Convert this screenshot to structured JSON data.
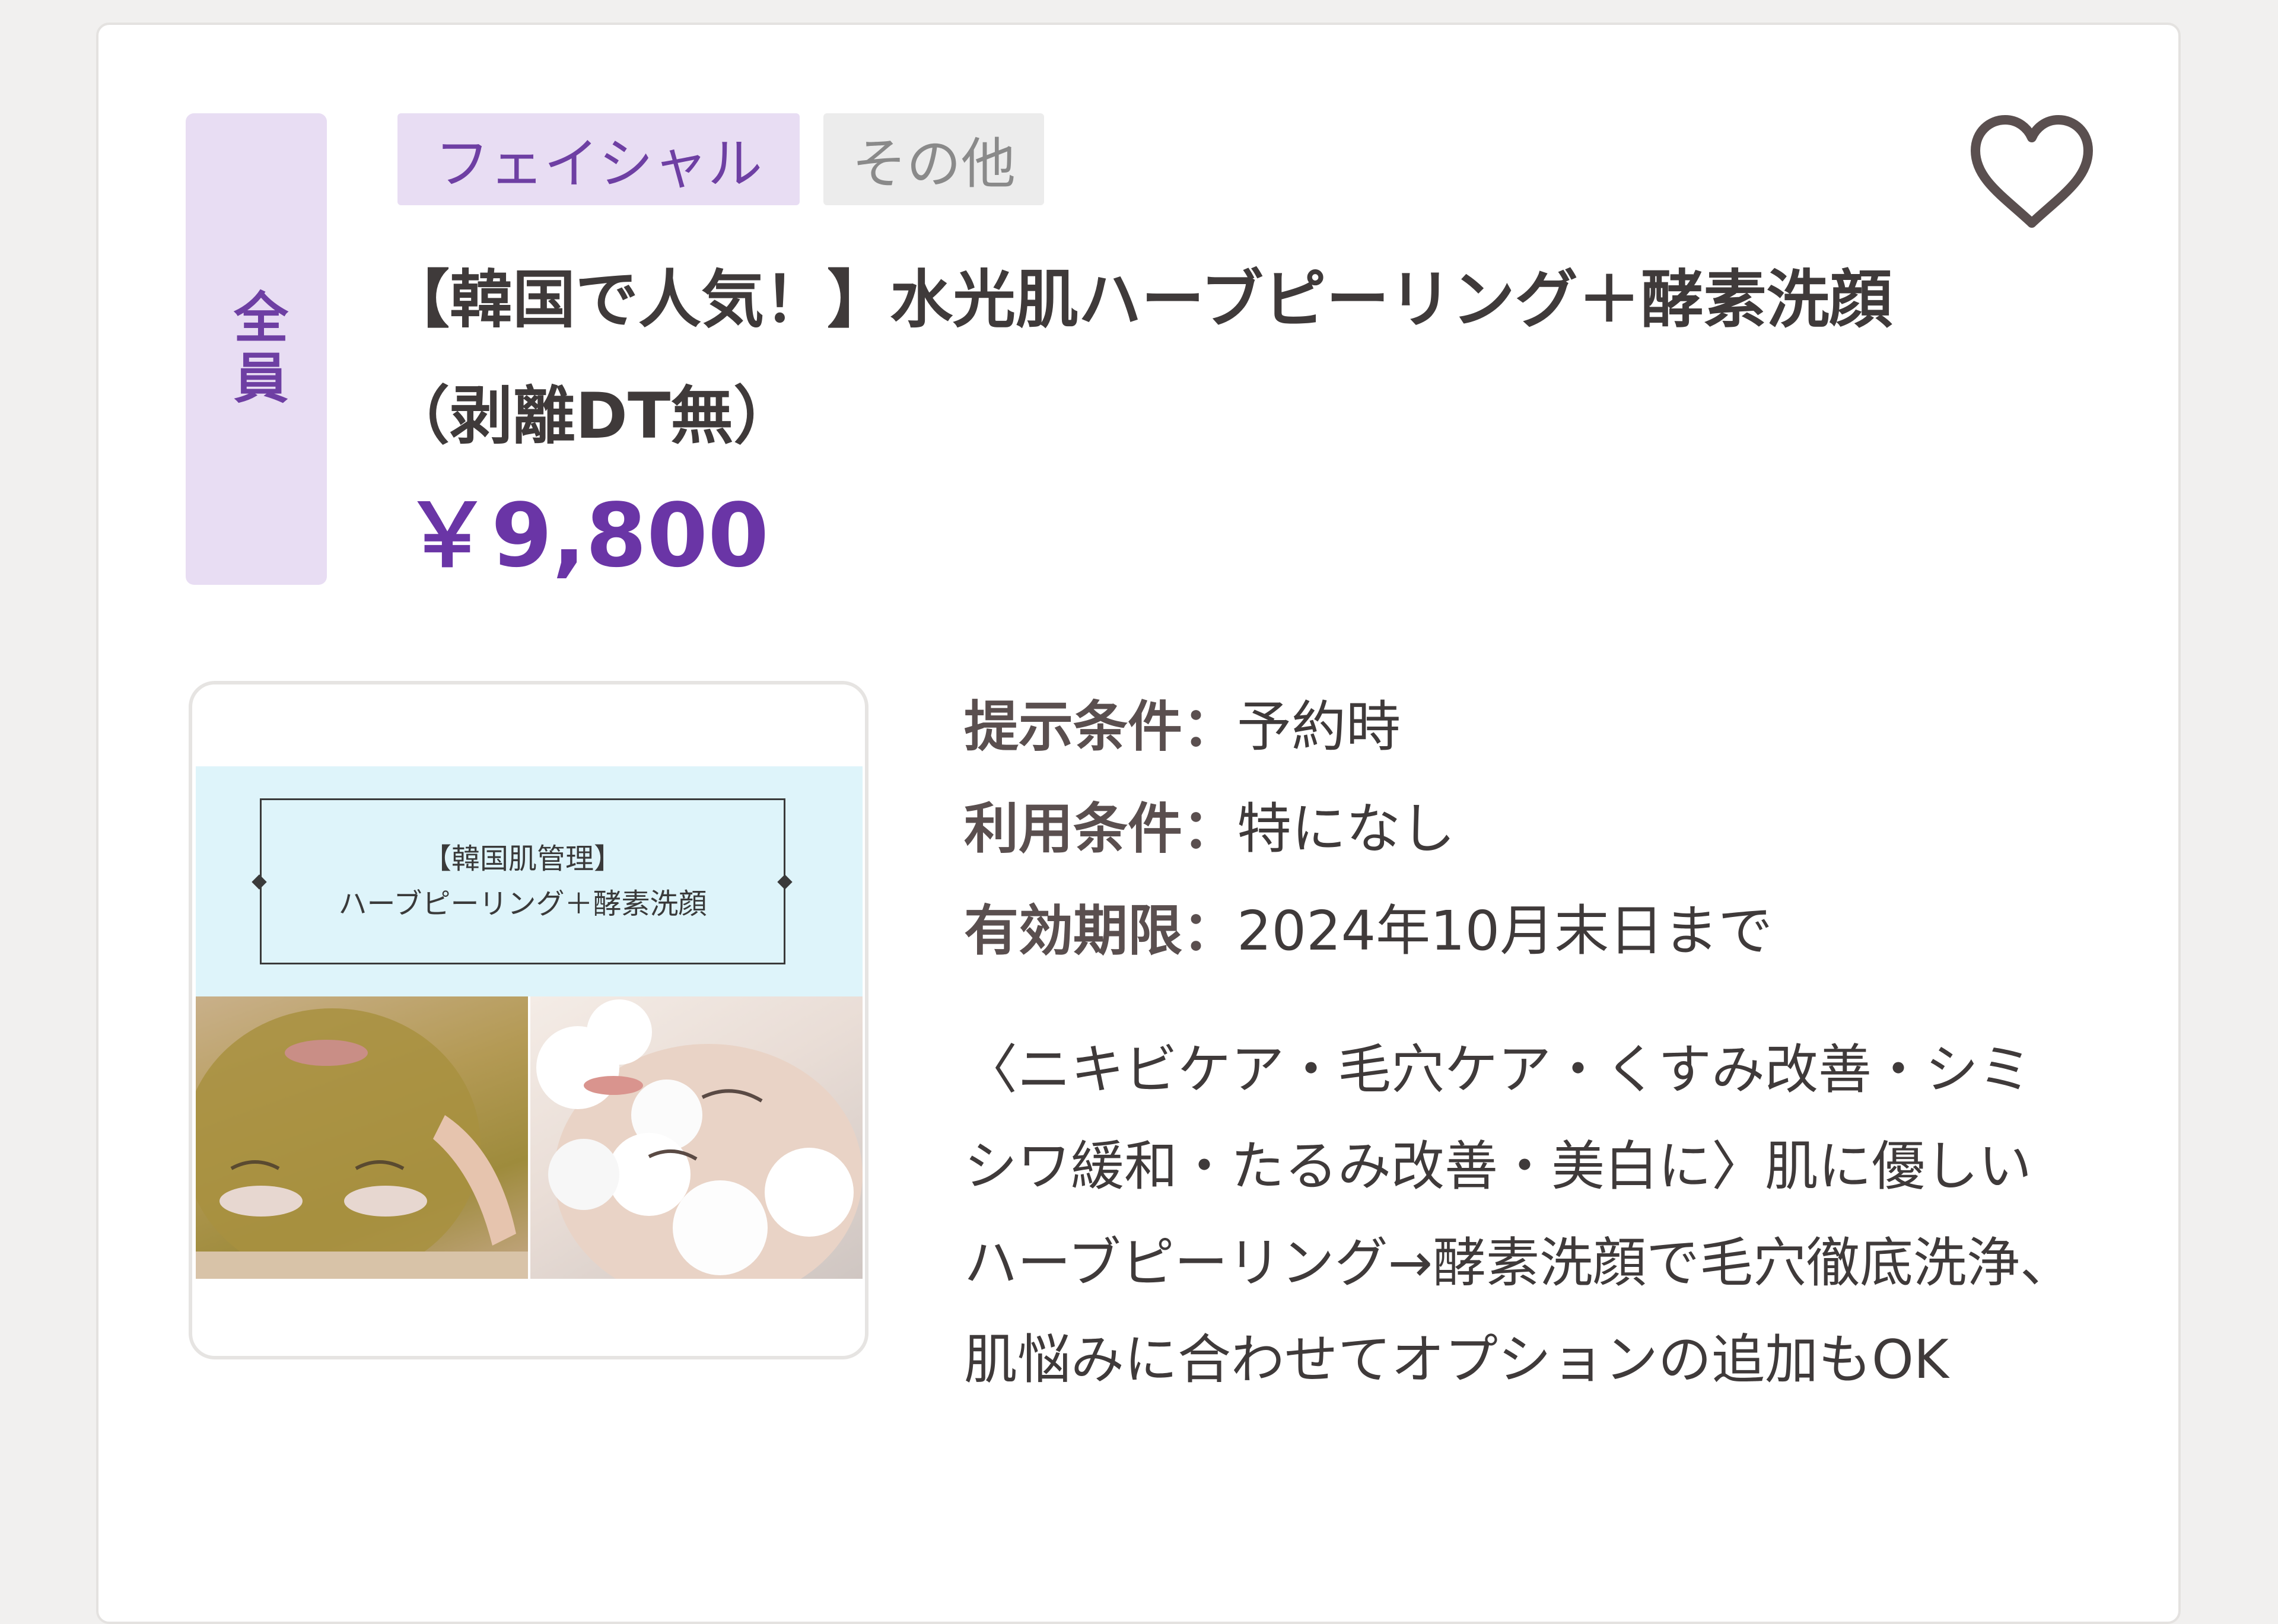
{
  "card": {
    "member_badge": "全員",
    "tags": [
      {
        "label": "フェイシャル"
      },
      {
        "label": "その他"
      }
    ],
    "favorite_icon": "heart-outline-icon",
    "title": "【韓国で人気！】水光肌ハーブピーリング＋酵素洗顔（剥離DT無）",
    "price": "￥9,800",
    "thumbnail": {
      "line1": "【韓国肌管理】",
      "line2": "ハーブピーリング＋酵素洗顔"
    },
    "conditions": [
      {
        "label": "提示条件：",
        "value": "予約時"
      },
      {
        "label": "利用条件：",
        "value": "特になし"
      },
      {
        "label": "有効期限：",
        "value": "2024年10月末日まで"
      }
    ],
    "description": "〈ニキビケア・毛穴ケア・くすみ改善・シミシワ緩和・たるみ改善・美白に〉肌に優しいハーブピーリング→酵素洗顔で毛穴徹底洗浄、肌悩みに合わせてオプションの追加もOK"
  },
  "colors": {
    "accent": "#6a35a6",
    "badge_bg": "#e8ddf3",
    "text": "#3f3a3a",
    "page_bg": "#f1f0ef"
  }
}
